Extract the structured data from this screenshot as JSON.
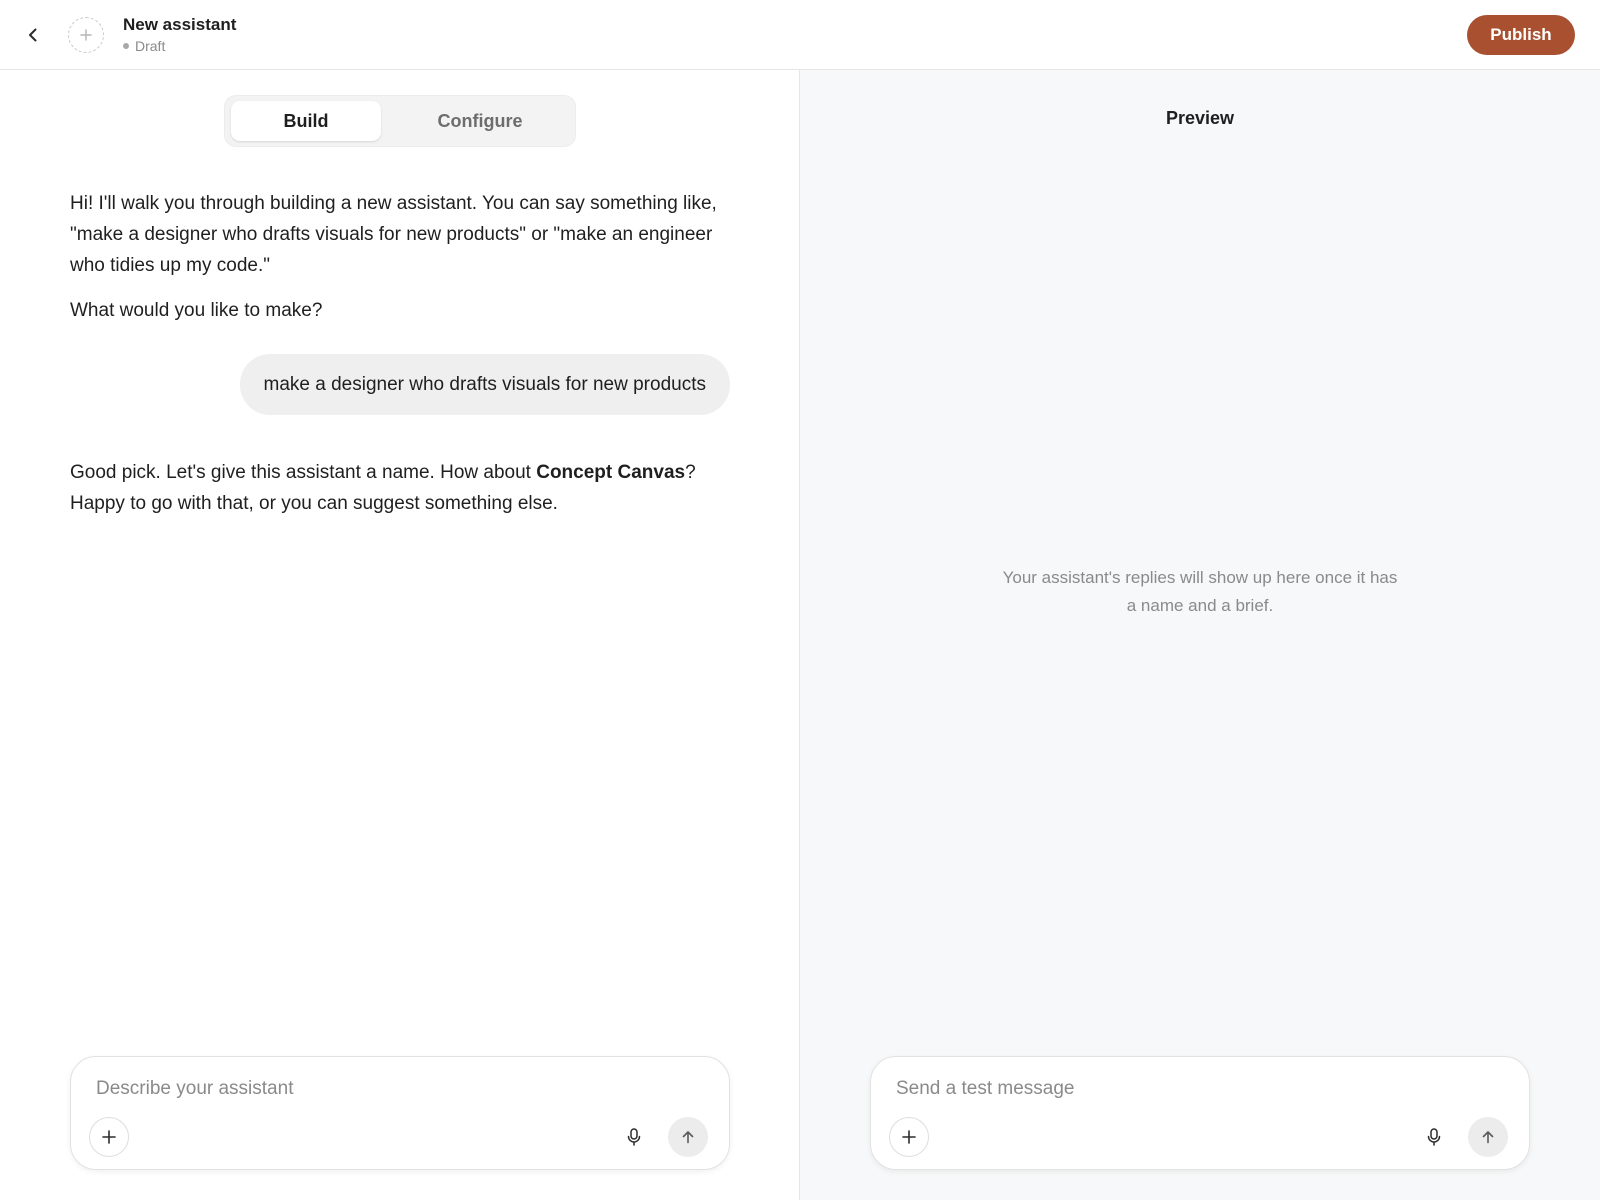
{
  "header": {
    "back_icon": "chevron-left-icon",
    "avatar_icon": "plus-icon",
    "title": "New assistant",
    "status": "Draft",
    "publish_label": "Publish",
    "accent_color": "#a8502f"
  },
  "build": {
    "tabs": [
      {
        "label": "Build",
        "active": true
      },
      {
        "label": "Configure",
        "active": false
      }
    ],
    "messages": {
      "intro_p1": "Hi! I'll walk you through building a new assistant. You can say something like, \"make a designer who drafts visuals for new products\" or \"make an engineer who tidies up my code.\"",
      "intro_p2": "What would you like to make?",
      "user_message": "make a designer who drafts visuals for new products",
      "reply_before": "Good pick. Let's give this assistant a name. How about ",
      "reply_name": "Concept Canvas",
      "reply_after": "? Happy to go with that, or you can suggest something else."
    },
    "composer": {
      "placeholder": "Describe your assistant",
      "attach_icon": "plus-icon",
      "mic_icon": "microphone-icon",
      "send_icon": "arrow-up-icon"
    }
  },
  "preview": {
    "title": "Preview",
    "empty_text": "Your assistant's replies will show up here once it has a name and a brief.",
    "composer": {
      "placeholder": "Send a test message",
      "attach_icon": "plus-icon",
      "mic_icon": "microphone-icon",
      "send_icon": "arrow-up-icon"
    }
  }
}
